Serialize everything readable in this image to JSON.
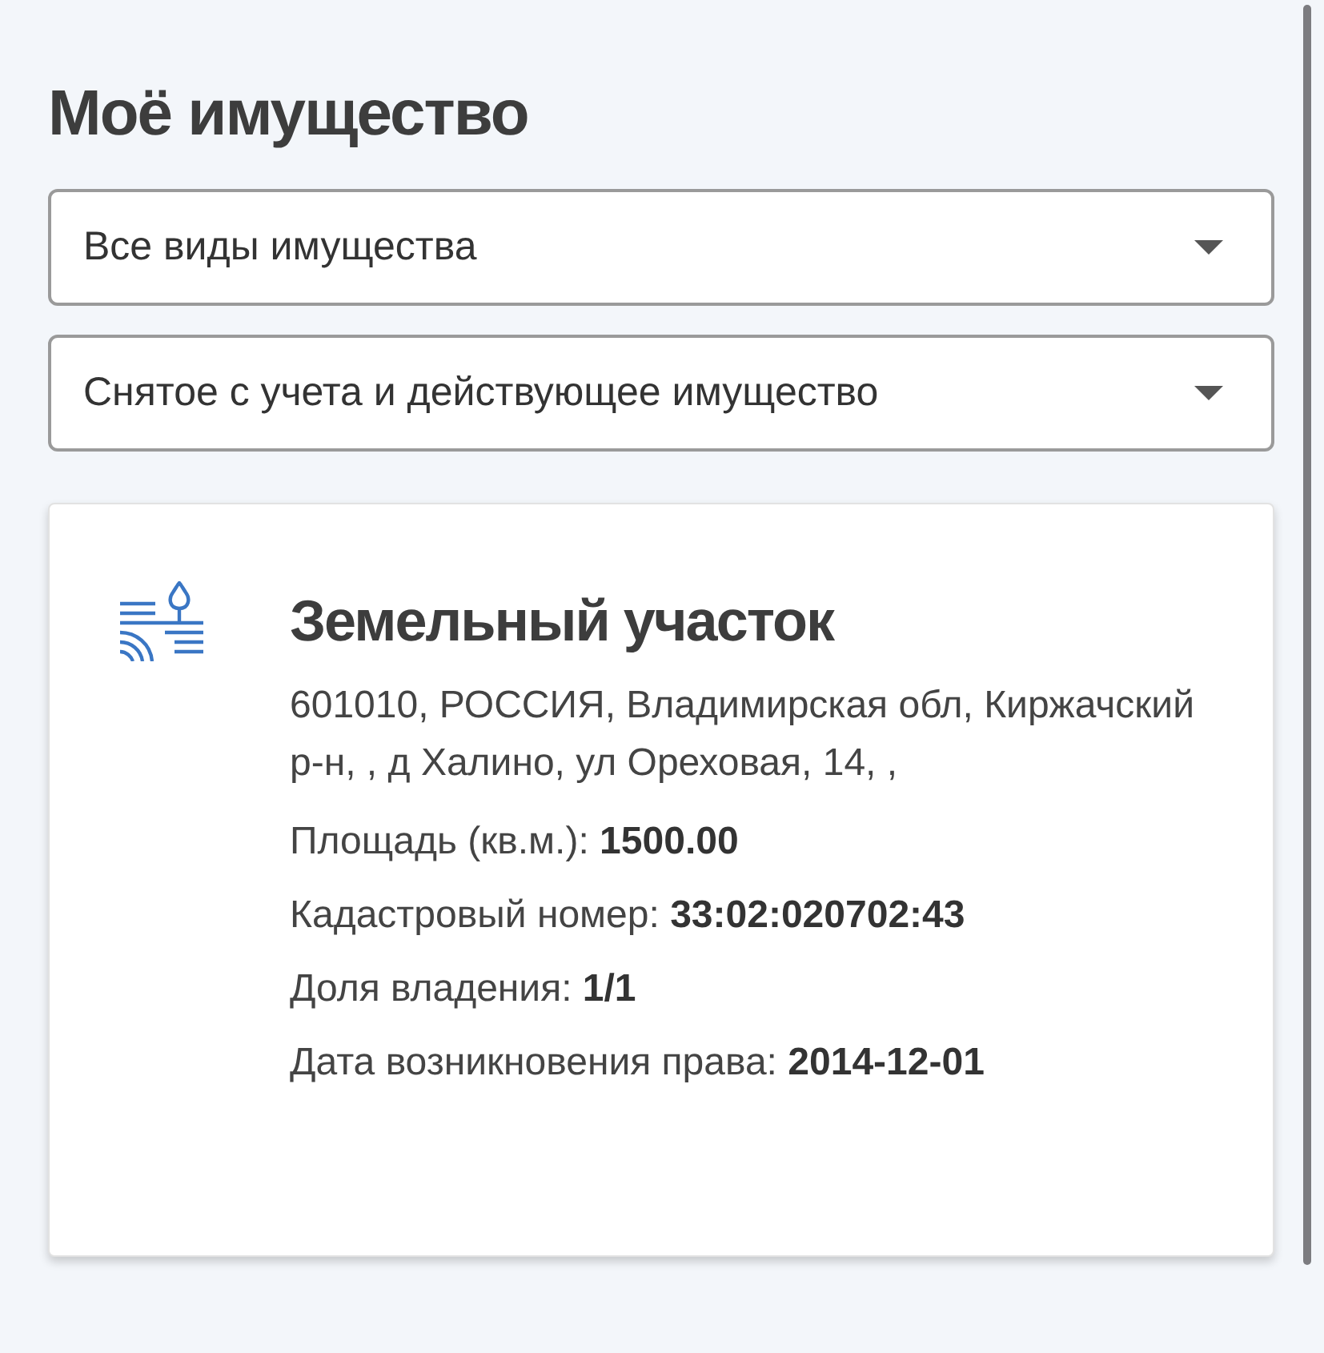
{
  "title": "Моё имущество",
  "filters": [
    {
      "value": "Все виды имущества"
    },
    {
      "value": "Снятое с учета и действующее имущество"
    }
  ],
  "properties": [
    {
      "kind": "land",
      "title": "Земельный участок",
      "address": "601010, РОССИЯ, Владимирская обл, Киржачский р-н, , д Халино, ул Ореховая, 14, ,",
      "details": [
        "Площадь (кв.м.): **1500.00**",
        "Кадастровый номер: **33:02:020702:43**",
        "Доля владения: **1/1**",
        "Дата возникновения права: **2014-12-01**"
      ]
    }
  ]
}
